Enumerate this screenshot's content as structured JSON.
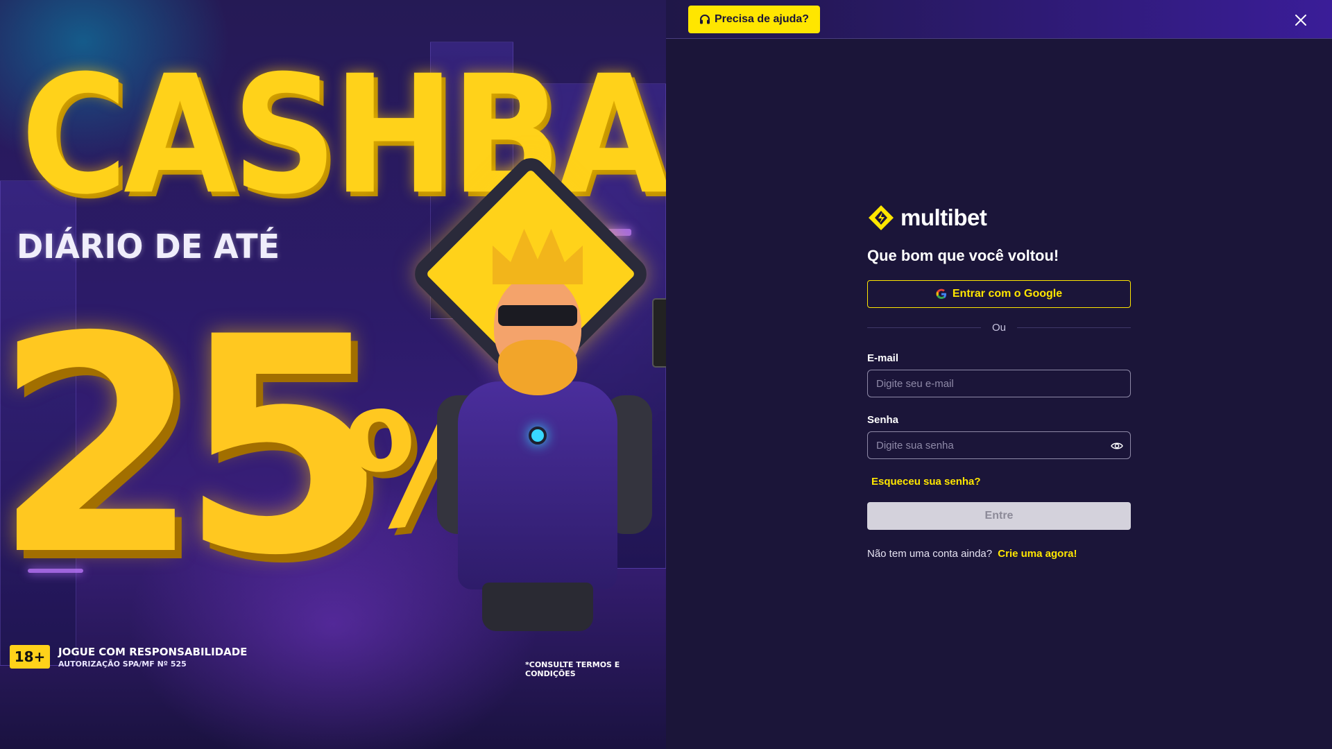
{
  "promo": {
    "headline": "CASHBACK",
    "subheadline": "DIÁRIO DE ATÉ",
    "percent_number": "25",
    "percent_sign": "%",
    "age_badge": "18+",
    "responsibility_line1": "JOGUE COM RESPONSABILIDADE",
    "responsibility_line2": "AUTORIZAÇÃO SPA/MF Nº 525",
    "terms": "*CONSULTE TERMOS E CONDIÇÕES"
  },
  "topbar": {
    "help_label": "Precisa de ajuda?",
    "help_icon": "headset-icon",
    "close_icon": "close-icon"
  },
  "brand": {
    "name": "multibet",
    "accent": "#ffe600"
  },
  "login": {
    "title": "Que bom que você voltou!",
    "google_label": "Entrar com o Google",
    "divider_label": "Ou",
    "email_label": "E-mail",
    "email_placeholder": "Digite seu e-mail",
    "email_value": "",
    "password_label": "Senha",
    "password_placeholder": "Digite sua senha",
    "password_value": "",
    "forgot_label": "Esqueceu sua senha?",
    "submit_label": "Entre",
    "signup_prompt": "Não tem uma conta ainda?",
    "signup_link": "Crie uma agora!"
  },
  "colors": {
    "panel_bg": "#1b1539",
    "accent_yellow": "#ffe600",
    "disabled_button": "#d4d2dc"
  }
}
